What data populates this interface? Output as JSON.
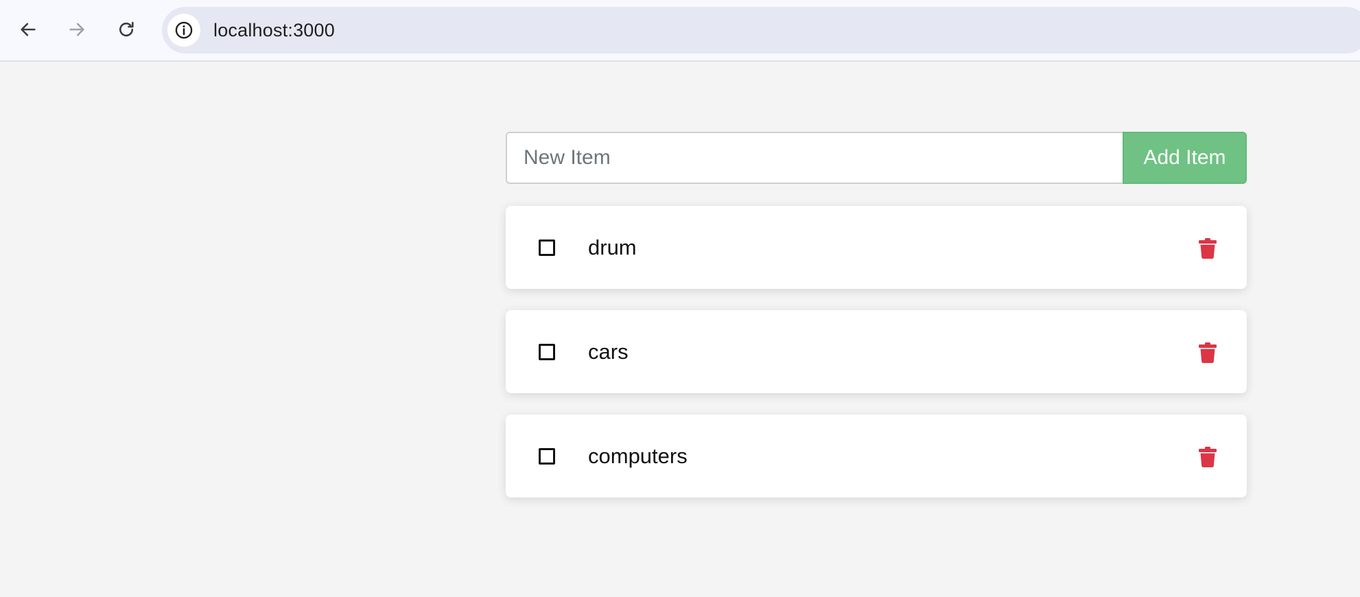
{
  "browser": {
    "url": "localhost:3000",
    "icons": {
      "back": "arrow-left-icon",
      "forward": "arrow-right-icon",
      "reload": "reload-icon",
      "site_info": "info-icon"
    }
  },
  "form": {
    "input_placeholder": "New Item",
    "input_value": "",
    "add_label": "Add Item"
  },
  "todos": [
    {
      "label": "drum",
      "checked": false
    },
    {
      "label": "cars",
      "checked": false
    },
    {
      "label": "computers",
      "checked": false
    }
  ],
  "colors": {
    "accent_green": "#6fc283",
    "delete_red": "#dc3545",
    "page_background": "#f4f4f4"
  }
}
